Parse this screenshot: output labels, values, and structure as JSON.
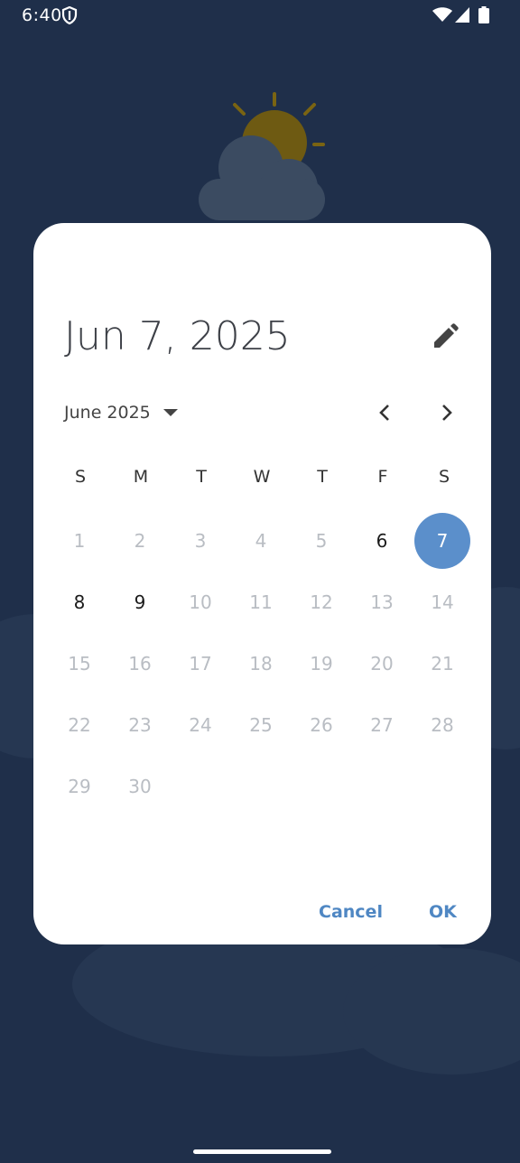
{
  "status_bar": {
    "time": "6:40"
  },
  "dialog": {
    "selected_date": "Jun 7, 2025",
    "month_label": "June 2025",
    "weekdays": [
      "S",
      "M",
      "T",
      "W",
      "T",
      "F",
      "S"
    ],
    "weeks": [
      [
        "",
        "",
        "",
        "",
        "",
        "",
        ""
      ],
      [
        "1",
        "2",
        "3",
        "4",
        "5",
        "6",
        "7"
      ],
      [
        "8",
        "9",
        "10",
        "11",
        "12",
        "13",
        "14"
      ],
      [
        "15",
        "16",
        "17",
        "18",
        "19",
        "20",
        "21"
      ],
      [
        "22",
        "23",
        "24",
        "25",
        "26",
        "27",
        "28"
      ],
      [
        "29",
        "30",
        "",
        "",
        "",
        "",
        ""
      ]
    ],
    "enabled_days": [
      "6",
      "7",
      "8",
      "9"
    ],
    "selected_day": "7",
    "cancel_label": "Cancel",
    "ok_label": "OK"
  },
  "colors": {
    "background": "#1f2f4a",
    "accent": "#5b8fcb",
    "action_text": "#4f87c3",
    "disabled_day": "#b9bdc3"
  },
  "icons": [
    "shield-icon",
    "wifi-icon",
    "signal-icon",
    "battery-icon",
    "sun-cloud-icon",
    "pencil-icon",
    "caret-down-icon",
    "chevron-left-icon",
    "chevron-right-icon"
  ]
}
